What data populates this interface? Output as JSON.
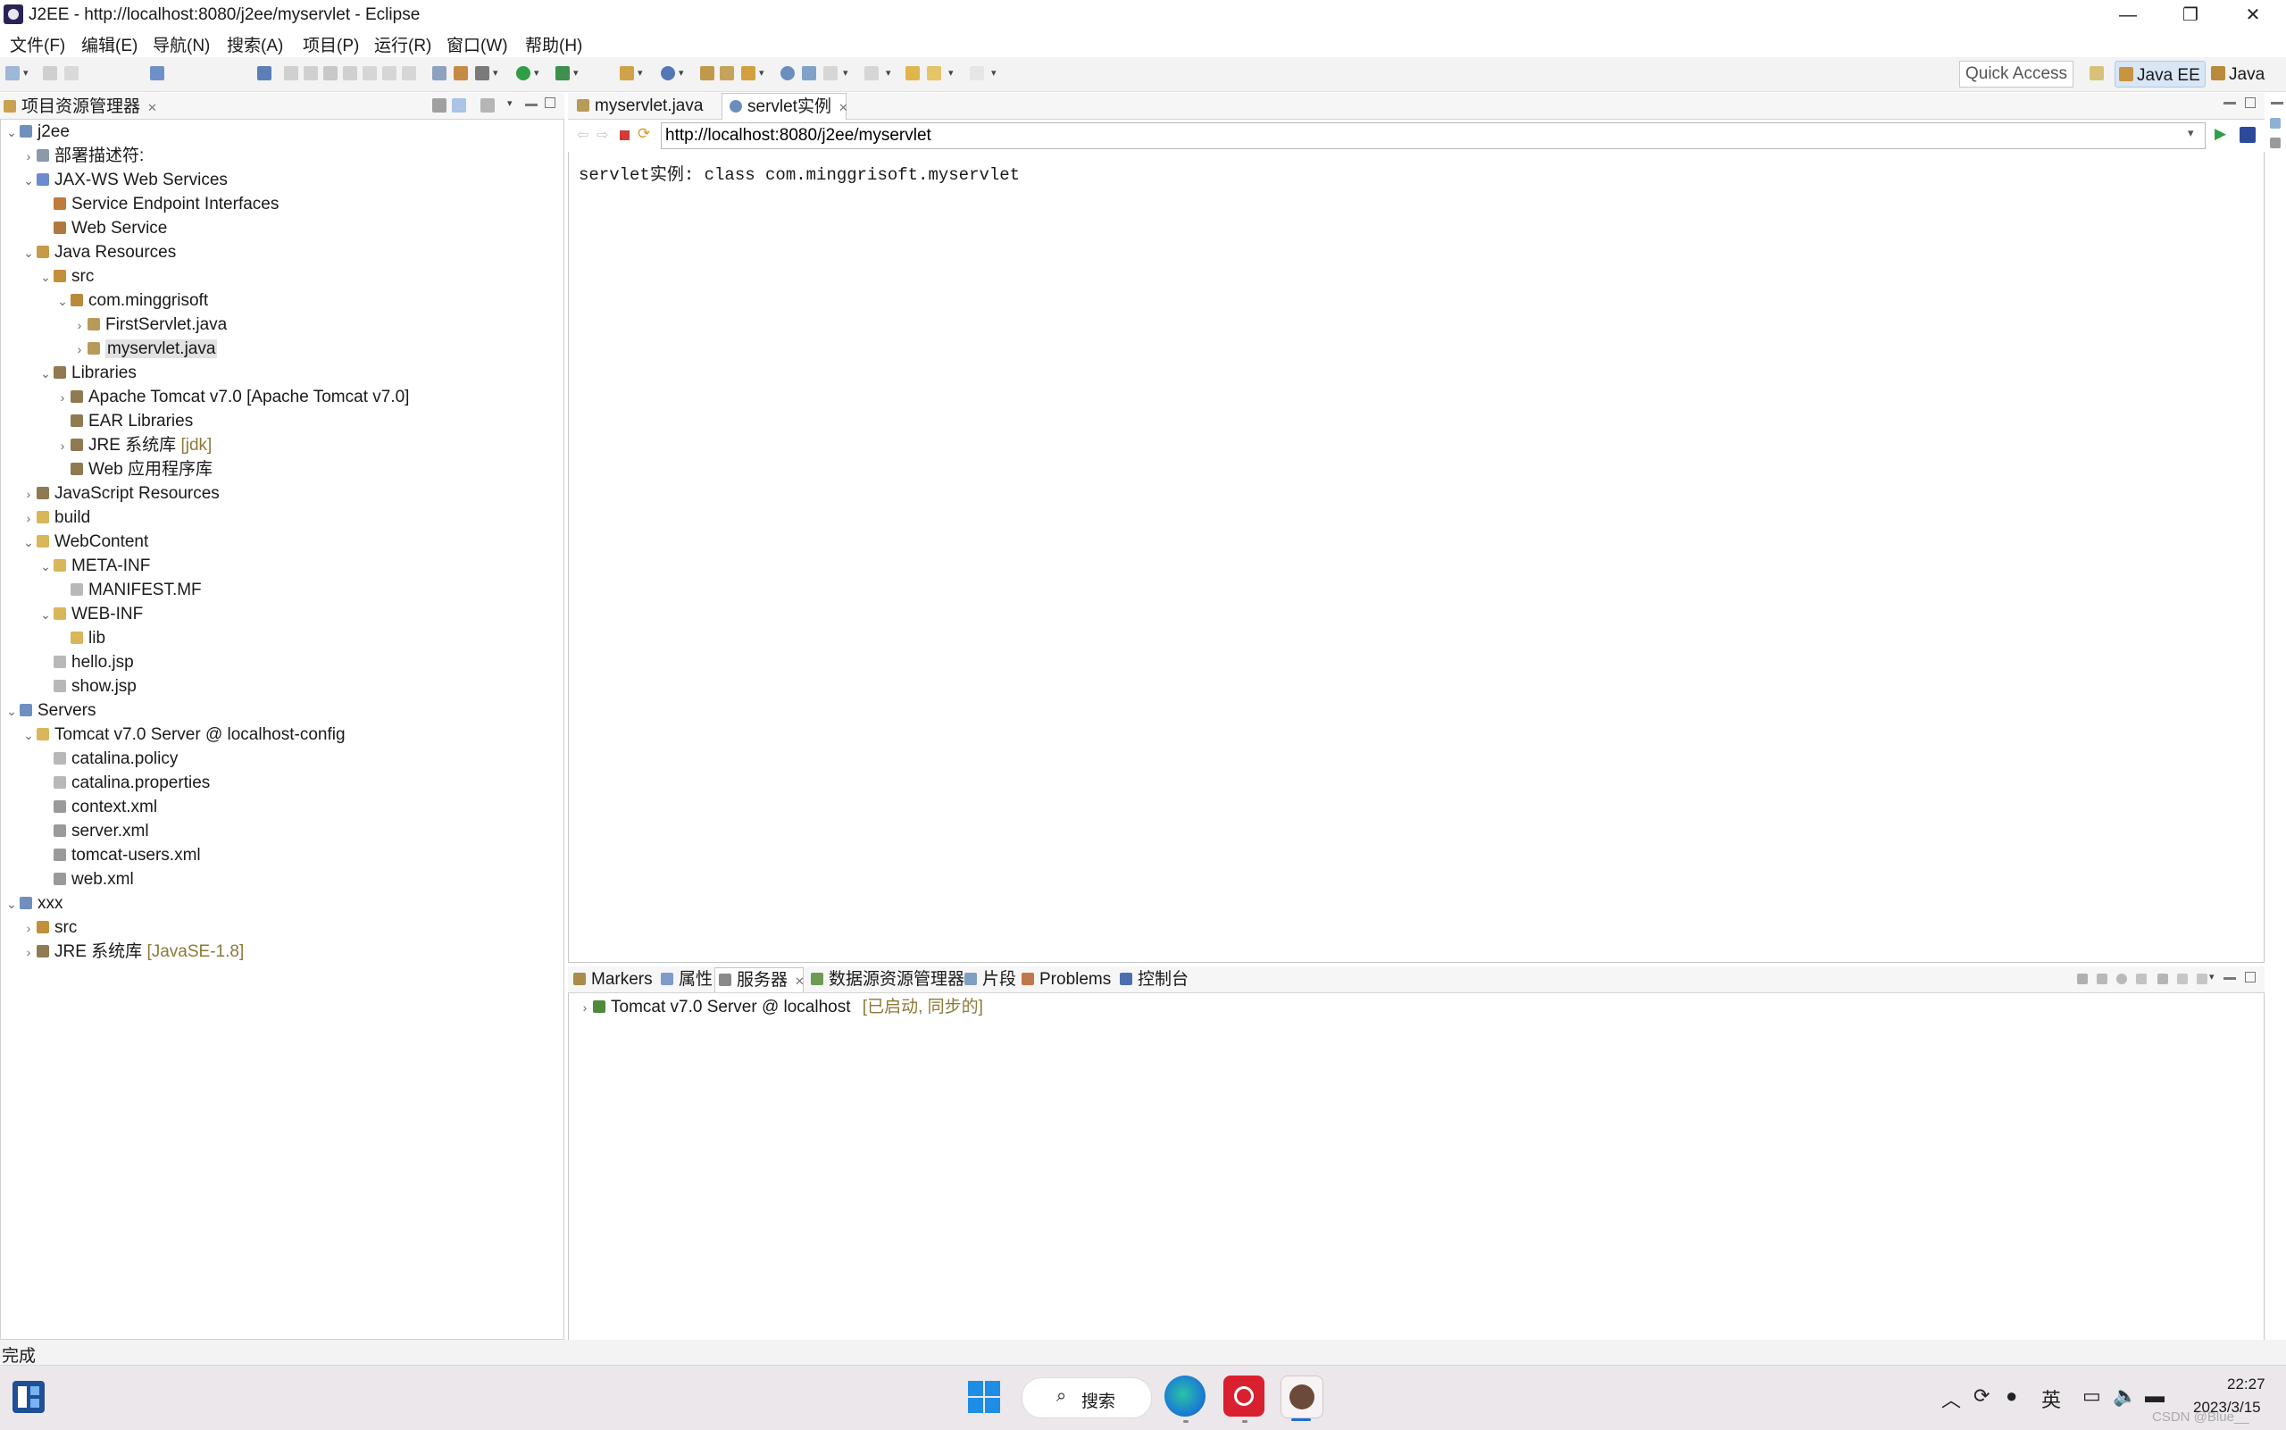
{
  "window": {
    "title": "J2EE - http://localhost:8080/j2ee/myservlet - Eclipse",
    "controls": {
      "minimize": "—",
      "restore": "❐",
      "close": "✕"
    }
  },
  "menubar": [
    "文件(F)",
    "编辑(E)",
    "导航(N)",
    "搜索(A)",
    "项目(P)",
    "运行(R)",
    "窗口(W)",
    "帮助(H)"
  ],
  "toolbar": {
    "quick_access": "Quick Access",
    "perspectives": [
      {
        "label": "Java EE",
        "active": true
      },
      {
        "label": "Java",
        "active": false
      }
    ]
  },
  "explorer": {
    "tab_label": "项目资源管理器",
    "tree": [
      {
        "label": "j2ee",
        "depth": 0,
        "twisty": "open",
        "icon": "project"
      },
      {
        "label": "部署描述符:",
        "depth": 1,
        "twisty": "closed",
        "icon": "descriptor"
      },
      {
        "label": "JAX-WS Web Services",
        "depth": 1,
        "twisty": "open",
        "icon": "webservices"
      },
      {
        "label": "Service Endpoint Interfaces",
        "depth": 2,
        "twisty": "none",
        "icon": "sei"
      },
      {
        "label": "Web Service",
        "depth": 2,
        "twisty": "none",
        "icon": "webservice"
      },
      {
        "label": "Java Resources",
        "depth": 1,
        "twisty": "open",
        "icon": "javares"
      },
      {
        "label": "src",
        "depth": 2,
        "twisty": "open",
        "icon": "srcfolder"
      },
      {
        "label": "com.minggrisoft",
        "depth": 3,
        "twisty": "open",
        "icon": "package"
      },
      {
        "label": "FirstServlet.java",
        "depth": 4,
        "twisty": "closed",
        "icon": "javafile"
      },
      {
        "label": "myservlet.java",
        "depth": 4,
        "twisty": "closed",
        "icon": "javafile",
        "selected": true
      },
      {
        "label": "Libraries",
        "depth": 2,
        "twisty": "open",
        "icon": "library"
      },
      {
        "label": "Apache Tomcat v7.0 [Apache Tomcat v7.0]",
        "depth": 3,
        "twisty": "closed",
        "icon": "library"
      },
      {
        "label": "EAR Libraries",
        "depth": 3,
        "twisty": "none",
        "icon": "library"
      },
      {
        "label": "JRE 系统库",
        "suffix": " [jdk]",
        "depth": 3,
        "twisty": "closed",
        "icon": "library"
      },
      {
        "label": "Web 应用程序库",
        "depth": 3,
        "twisty": "none",
        "icon": "library"
      },
      {
        "label": "JavaScript Resources",
        "depth": 1,
        "twisty": "closed",
        "icon": "library"
      },
      {
        "label": "build",
        "depth": 1,
        "twisty": "closed",
        "icon": "folder"
      },
      {
        "label": "WebContent",
        "depth": 1,
        "twisty": "open",
        "icon": "folder"
      },
      {
        "label": "META-INF",
        "depth": 2,
        "twisty": "open",
        "icon": "folder"
      },
      {
        "label": "MANIFEST.MF",
        "depth": 3,
        "twisty": "none",
        "icon": "file"
      },
      {
        "label": "WEB-INF",
        "depth": 2,
        "twisty": "open",
        "icon": "folder"
      },
      {
        "label": "lib",
        "depth": 3,
        "twisty": "none",
        "icon": "folder"
      },
      {
        "label": "hello.jsp",
        "depth": 2,
        "twisty": "none",
        "icon": "file"
      },
      {
        "label": "show.jsp",
        "depth": 2,
        "twisty": "none",
        "icon": "file"
      },
      {
        "label": "Servers",
        "depth": 0,
        "twisty": "open",
        "icon": "project"
      },
      {
        "label": "Tomcat v7.0 Server @ localhost-config",
        "depth": 1,
        "twisty": "open",
        "icon": "folder"
      },
      {
        "label": "catalina.policy",
        "depth": 2,
        "twisty": "none",
        "icon": "file"
      },
      {
        "label": "catalina.properties",
        "depth": 2,
        "twisty": "none",
        "icon": "file"
      },
      {
        "label": "context.xml",
        "depth": 2,
        "twisty": "none",
        "icon": "xmlfile"
      },
      {
        "label": "server.xml",
        "depth": 2,
        "twisty": "none",
        "icon": "xmlfile"
      },
      {
        "label": "tomcat-users.xml",
        "depth": 2,
        "twisty": "none",
        "icon": "xmlfile"
      },
      {
        "label": "web.xml",
        "depth": 2,
        "twisty": "none",
        "icon": "xmlfile"
      },
      {
        "label": "xxx",
        "depth": 0,
        "twisty": "open",
        "icon": "project"
      },
      {
        "label": "src",
        "depth": 1,
        "twisty": "closed",
        "icon": "srcfolder"
      },
      {
        "label": "JRE 系统库",
        "suffix": " [JavaSE-1.8]",
        "depth": 1,
        "twisty": "closed",
        "icon": "library"
      }
    ]
  },
  "editor": {
    "tabs": [
      {
        "label": "myservlet.java",
        "active": false
      },
      {
        "label": "servlet实例",
        "active": true
      }
    ],
    "url": "http://localhost:8080/j2ee/myservlet",
    "content": "servlet实例: class com.minggrisoft.myservlet"
  },
  "bottom": {
    "tabs": [
      {
        "label": "Markers",
        "active": false
      },
      {
        "label": "属性",
        "active": false
      },
      {
        "label": "服务器",
        "active": true
      },
      {
        "label": "数据源资源管理器",
        "active": false
      },
      {
        "label": "片段",
        "active": false
      },
      {
        "label": "Problems",
        "active": false
      },
      {
        "label": "控制台",
        "active": false
      }
    ],
    "server_row": {
      "label": "Tomcat v7.0 Server @ localhost",
      "status": "[已启动, 同步的]"
    }
  },
  "statusbar": {
    "text": "完成"
  },
  "taskbar": {
    "search_label": "搜索",
    "tray_lang": "英",
    "time": "22:27",
    "date": "2023/3/15",
    "watermark": "CSDN @Blue__"
  },
  "colors": {
    "accent": "#d8e6f5",
    "suffix": "#8b7a38",
    "server_status": "#8b7a38"
  }
}
